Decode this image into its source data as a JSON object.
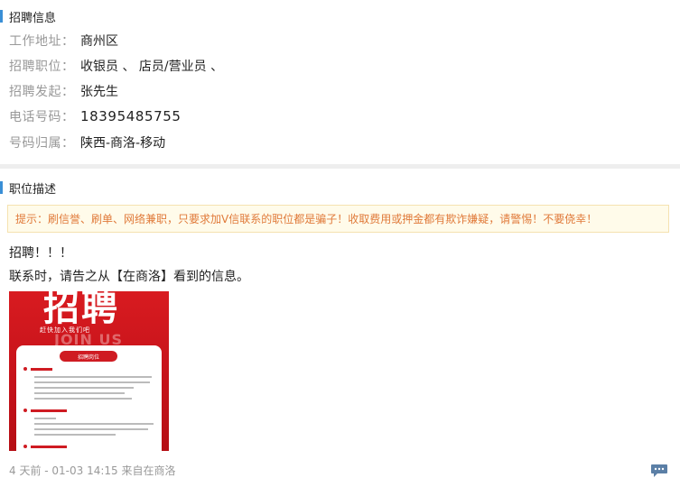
{
  "recruit_section": {
    "title": "招聘信息"
  },
  "info": [
    {
      "label": "工作地址：",
      "value": "商州区"
    },
    {
      "label": "招聘职位：",
      "value": "收银员 、 店员/营业员 、"
    },
    {
      "label": "招聘发起：",
      "value": "张先生"
    },
    {
      "label": "电话号码：",
      "value": "18395485755"
    },
    {
      "label": "号码归属：",
      "value": "陕西-商洛-移动"
    }
  ],
  "desc_section": {
    "title": "职位描述"
  },
  "warning": "提示：刷信誉、刷单、网络兼职，只要求加V信联系的职位都是骗子！收取费用或押金都有欺诈嫌疑，请警惕！不要侥幸！",
  "body": {
    "line1": "招聘！！！",
    "line2": "联系时，请告之从【在商洛】看到的信息。"
  },
  "poster": {
    "headline": "招聘",
    "subline": "赶快加入我们吧",
    "watermark": "JOIN US",
    "card_title": "招聘岗位"
  },
  "footer": {
    "meta": "4 天前 - 01-03 14:15 来自在商洛"
  },
  "colors": {
    "accent_bar": "#3a8fd6",
    "warning_text": "#e07a3a",
    "poster_red": "#d81b20"
  },
  "icons": {
    "reply": "chat-bubble-icon"
  }
}
